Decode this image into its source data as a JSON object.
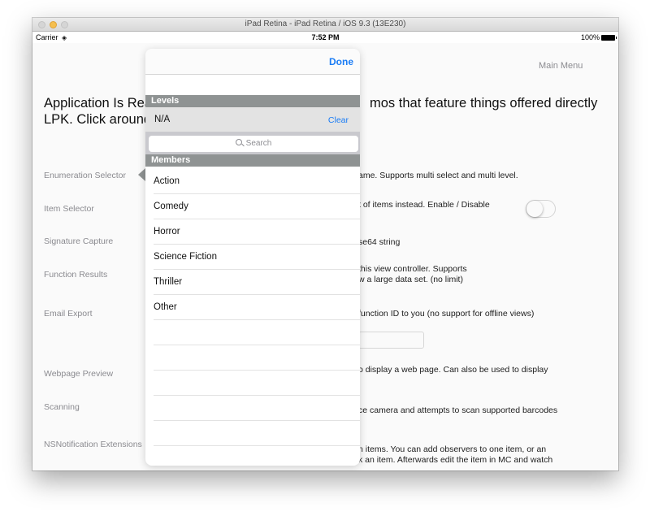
{
  "window": {
    "title": "iPad Retina - iPad Retina / iOS 9.3 (13E230)"
  },
  "status_bar": {
    "carrier": "Carrier",
    "time": "7:52 PM",
    "battery": "100%"
  },
  "nav": {
    "main_menu": "Main Menu"
  },
  "heading": {
    "line1_left": "Application Is Rea",
    "line1_right": "mos that feature things offered directly",
    "line2": "LPK. Click around"
  },
  "rows": [
    {
      "label": "Enumeration Selector",
      "desc": [
        "ame. Supports multi select and multi level."
      ]
    },
    {
      "label": "Item Selector",
      "desc": [
        "t of items instead. Enable / Disable"
      ]
    },
    {
      "label": "Signature Capture",
      "desc": [
        "se64 string"
      ]
    },
    {
      "label": "Function Results",
      "desc": [
        "this view controller.  Supports",
        "w a large data set. (no limit)"
      ]
    },
    {
      "label": "Email Export",
      "desc": [
        "function ID to you (no support for offline views)"
      ]
    },
    {
      "label": "Webpage Preview",
      "desc": [
        "o display a web page. Can also be used to display"
      ]
    },
    {
      "label": "Scanning",
      "desc": [
        "ce camera and attempts to scan supported barcodes"
      ]
    },
    {
      "label": "NSNotification Extensions",
      "desc": [
        "n items.  You can add observers to one item, or an",
        "k an item. Afterwards edit the item in MC and watch"
      ]
    }
  ],
  "popover": {
    "done_label": "Done",
    "levels_header": "Levels",
    "level_value": "N/A",
    "clear_label": "Clear",
    "search_placeholder": "Search",
    "members_header": "Members",
    "members": [
      "Action",
      "Comedy",
      "Horror",
      "Science Fiction",
      "Thriller",
      "Other"
    ]
  },
  "icons": {
    "wifi": "wifi-icon",
    "battery": "battery-icon",
    "search": "search-icon"
  },
  "colors": {
    "accent": "#1a7cf5",
    "section_header": "#8f9393",
    "selected_row": "#e3e3e3",
    "search_bar": "#c9c9ce"
  }
}
